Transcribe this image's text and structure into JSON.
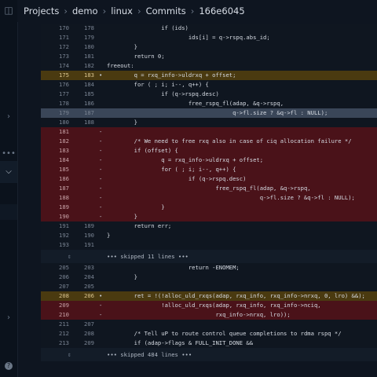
{
  "breadcrumb": [
    "Projects",
    "demo",
    "linux",
    "Commits",
    "166e6045"
  ],
  "leftbar_icons": [
    "panel-toggle",
    "chevron-right",
    "more",
    "chevron-down",
    "chevron-right",
    "help"
  ],
  "rows": [
    {
      "type": "norm",
      "o": "170",
      "n": "178",
      "m": "",
      "code": "                if (ids)"
    },
    {
      "type": "norm",
      "o": "171",
      "n": "179",
      "m": "",
      "code": "                        ids[i] = q->rspq.abs_id;"
    },
    {
      "type": "norm",
      "o": "172",
      "n": "180",
      "m": "",
      "code": "        }"
    },
    {
      "type": "norm",
      "o": "173",
      "n": "181",
      "m": "",
      "code": "        return 0;"
    },
    {
      "type": "norm",
      "o": "174",
      "n": "182",
      "m": "",
      "code": "freeout:"
    },
    {
      "type": "mod",
      "o": "175",
      "n": "183",
      "m": "•",
      "code": "        q = rxq_info->uldrxq + offset;",
      "hl": "+ offset"
    },
    {
      "type": "norm",
      "o": "176",
      "n": "184",
      "m": "",
      "code": "        for ( ; i; i--, q++) {"
    },
    {
      "type": "norm",
      "o": "177",
      "n": "185",
      "m": "",
      "code": "                if (q->rspq.desc)"
    },
    {
      "type": "norm",
      "o": "178",
      "n": "186",
      "m": "",
      "code": "                        free_rspq_fl(adap, &q->rspq,"
    },
    {
      "type": "hl",
      "o": "179",
      "n": "187",
      "m": "",
      "code": "                                     q->fl.size ? &q->fl : NULL);"
    },
    {
      "type": "norm",
      "o": "180",
      "n": "188",
      "m": "",
      "code": "        }"
    },
    {
      "type": "del",
      "o": "181",
      "n": "",
      "m": "-",
      "code": ""
    },
    {
      "type": "del",
      "o": "182",
      "n": "",
      "m": "-",
      "code": "        /* We need to free rxq also in case of ciq allocation failure */"
    },
    {
      "type": "del",
      "o": "183",
      "n": "",
      "m": "-",
      "code": "        if (offset) {"
    },
    {
      "type": "del",
      "o": "184",
      "n": "",
      "m": "-",
      "code": "                q = rxq_info->uldrxq + offset;"
    },
    {
      "type": "del",
      "o": "185",
      "n": "",
      "m": "-",
      "code": "                for ( ; i; i--, q++) {"
    },
    {
      "type": "del",
      "o": "186",
      "n": "",
      "m": "-",
      "code": "                        if (q->rspq.desc)"
    },
    {
      "type": "del",
      "o": "187",
      "n": "",
      "m": "-",
      "code": "                                free_rspq_fl(adap, &q->rspq,"
    },
    {
      "type": "del",
      "o": "188",
      "n": "",
      "m": "-",
      "code": "                                             q->fl.size ? &q->fl : NULL);"
    },
    {
      "type": "del",
      "o": "189",
      "n": "",
      "m": "-",
      "code": "                }"
    },
    {
      "type": "del",
      "o": "190",
      "n": "",
      "m": "-",
      "code": "        }"
    },
    {
      "type": "norm",
      "o": "191",
      "n": "189",
      "m": "",
      "code": "        return err;"
    },
    {
      "type": "norm",
      "o": "192",
      "n": "190",
      "m": "",
      "code": "}"
    },
    {
      "type": "norm",
      "o": "193",
      "n": "191",
      "m": "",
      "code": ""
    },
    {
      "type": "skip",
      "text": "••• skipped 11 lines •••"
    },
    {
      "type": "norm",
      "o": "205",
      "n": "203",
      "m": "",
      "code": "                        return -ENOMEM;"
    },
    {
      "type": "norm",
      "o": "206",
      "n": "204",
      "m": "",
      "code": "        }"
    },
    {
      "type": "norm",
      "o": "207",
      "n": "205",
      "m": "",
      "code": ""
    },
    {
      "type": "mod",
      "o": "208",
      "n": "206",
      "m": "•",
      "code": "        ret = !(!alloc_uld_rxqs(adap, rxq_info, rxq_info->nrxq, 0, lro) &&);"
    },
    {
      "type": "del",
      "o": "209",
      "n": "",
      "m": "-",
      "code": "                !alloc_uld_rxqs(adap, rxq_info, rxq_info->nciq,"
    },
    {
      "type": "del",
      "o": "210",
      "n": "",
      "m": "-",
      "code": "                                rxq_info->nrxq, lro));"
    },
    {
      "type": "norm",
      "o": "211",
      "n": "207",
      "m": "",
      "code": ""
    },
    {
      "type": "norm",
      "o": "212",
      "n": "208",
      "m": "",
      "code": "        /* Tell uP to route control queue completions to rdma rspq */"
    },
    {
      "type": "norm",
      "o": "213",
      "n": "209",
      "m": "",
      "code": "        if (adap->flags & FULL_INIT_DONE &&"
    },
    {
      "type": "skip",
      "text": "••• skipped 484 lines •••"
    }
  ]
}
